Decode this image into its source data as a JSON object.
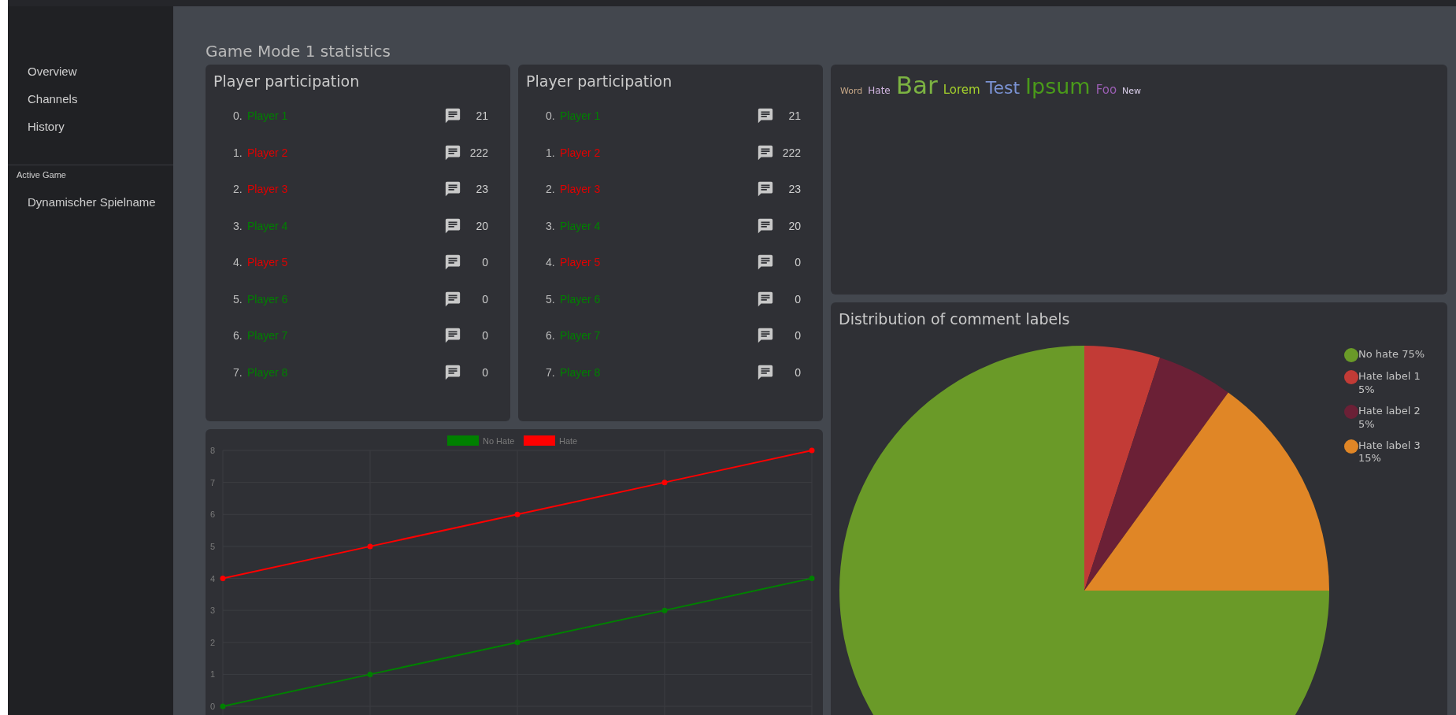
{
  "sidebar": {
    "nav_items": [
      "Overview",
      "Channels",
      "History"
    ],
    "section_title": "Active Game",
    "game_items": [
      "Dynamischer Spielname"
    ]
  },
  "page_title": "Game Mode 1 statistics",
  "participation_cards": [
    {
      "title": "Player participation",
      "players": [
        {
          "index": "0.",
          "name": "Player 1",
          "color": "#008000",
          "messages": "21"
        },
        {
          "index": "1.",
          "name": "Player 2",
          "color": "#e00000",
          "messages": "222"
        },
        {
          "index": "2.",
          "name": "Player 3",
          "color": "#e00000",
          "messages": "23"
        },
        {
          "index": "3.",
          "name": "Player 4",
          "color": "#008000",
          "messages": "20"
        },
        {
          "index": "4.",
          "name": "Player 5",
          "color": "#e00000",
          "messages": "0"
        },
        {
          "index": "5.",
          "name": "Player 6",
          "color": "#008000",
          "messages": "0"
        },
        {
          "index": "6.",
          "name": "Player 7",
          "color": "#008000",
          "messages": "0"
        },
        {
          "index": "7.",
          "name": "Player 8",
          "color": "#008000",
          "messages": "0"
        }
      ]
    },
    {
      "title": "Player participation",
      "players": [
        {
          "index": "0.",
          "name": "Player 1",
          "color": "#008000",
          "messages": "21"
        },
        {
          "index": "1.",
          "name": "Player 2",
          "color": "#e00000",
          "messages": "222"
        },
        {
          "index": "2.",
          "name": "Player 3",
          "color": "#e00000",
          "messages": "23"
        },
        {
          "index": "3.",
          "name": "Player 4",
          "color": "#008000",
          "messages": "20"
        },
        {
          "index": "4.",
          "name": "Player 5",
          "color": "#e00000",
          "messages": "0"
        },
        {
          "index": "5.",
          "name": "Player 6",
          "color": "#008000",
          "messages": "0"
        },
        {
          "index": "6.",
          "name": "Player 7",
          "color": "#008000",
          "messages": "0"
        },
        {
          "index": "7.",
          "name": "Player 8",
          "color": "#008000",
          "messages": "0"
        }
      ]
    }
  ],
  "word_cloud": {
    "words": [
      {
        "text": "Word",
        "color": "#c8a888"
      },
      {
        "text": "Hate",
        "color": "#d0b4e0"
      },
      {
        "text": "Bar",
        "color": "#7cb342"
      },
      {
        "text": "Lorem",
        "color": "#a4d02c"
      },
      {
        "text": "Test",
        "color": "#7b93d4"
      },
      {
        "text": "Ipsum",
        "color": "#4a9a1a"
      },
      {
        "text": "Foo",
        "color": "#9c5fb5"
      },
      {
        "text": "New",
        "color": "#dcd0ec"
      }
    ]
  },
  "line_chart": {
    "chart_data": {
      "type": "line",
      "series": [
        {
          "name": "No Hate",
          "color": "#008000",
          "values": [
            0,
            1,
            2,
            3,
            4
          ],
          "marker": "circle"
        },
        {
          "name": "Hate",
          "color": "#ff0000",
          "values": [
            4,
            5,
            6,
            7,
            8
          ],
          "marker": "circle"
        }
      ],
      "ylim": [
        0,
        8
      ],
      "yticks": [
        0,
        1,
        2,
        3,
        4,
        5,
        6,
        7,
        8
      ],
      "grid": true,
      "legend": true
    }
  },
  "pie_card": {
    "title": "Distribution of comment labels",
    "chart_data": {
      "type": "pie",
      "categories": [
        "No hate 75%",
        "Hate label 1 5%",
        "Hate label 2 5%",
        "Hate label 3 15%"
      ],
      "values": [
        75,
        5,
        5,
        15
      ],
      "colors": [
        "#6a9a28",
        "#c23b36",
        "#6b2036",
        "#e08626"
      ],
      "legend": true
    }
  }
}
